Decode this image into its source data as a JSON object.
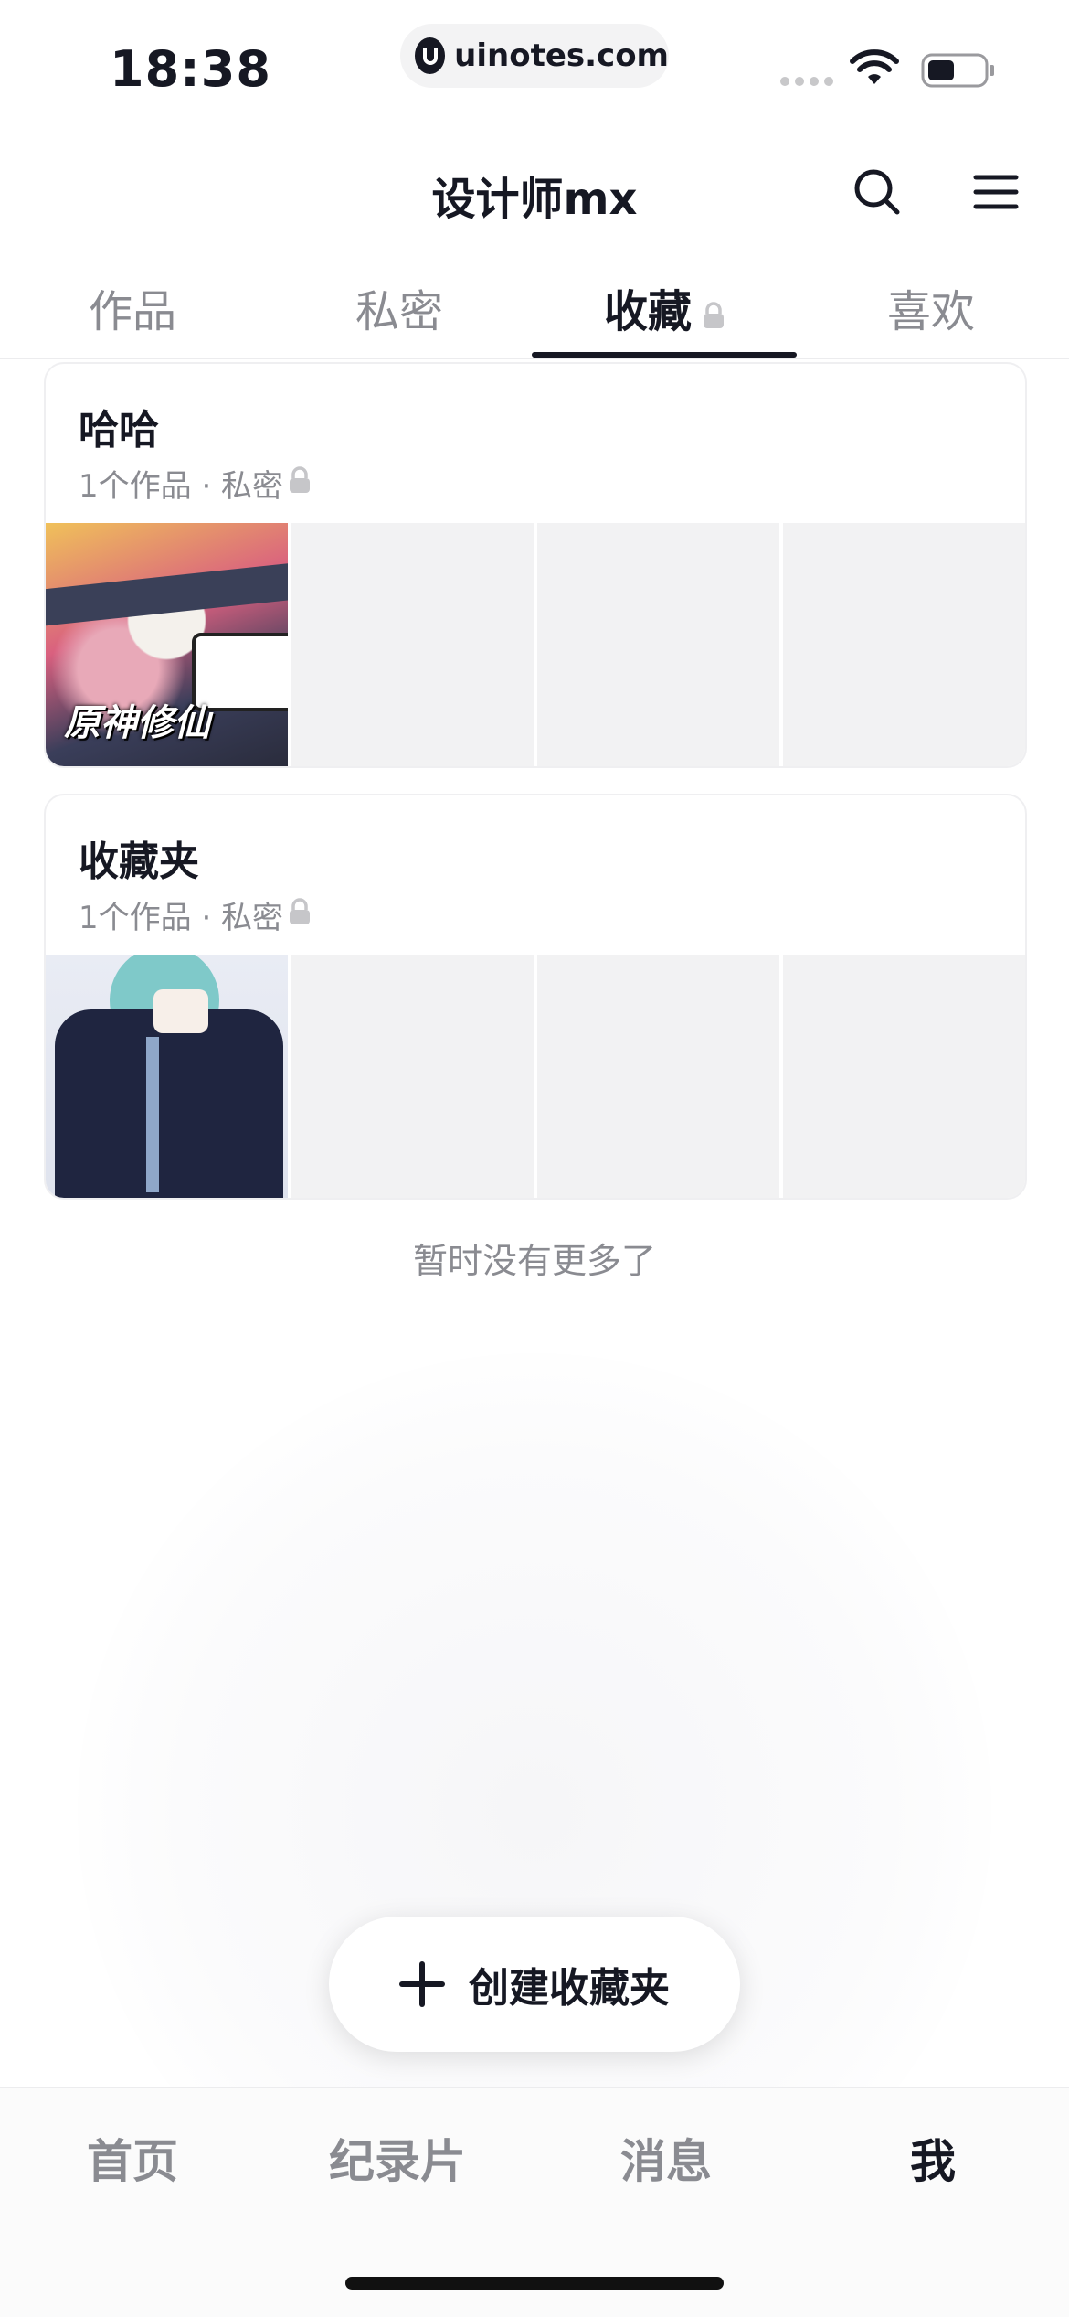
{
  "status_bar": {
    "time": "18:38",
    "url": "uinotes.com",
    "icons": [
      "cellular-icon",
      "wifi-icon",
      "battery-icon"
    ]
  },
  "header": {
    "title": "设计师mx",
    "icons": [
      "search-icon",
      "menu-icon"
    ]
  },
  "tabs": [
    {
      "label": "作品",
      "active": false
    },
    {
      "label": "私密",
      "active": false
    },
    {
      "label": "收藏",
      "active": true,
      "locked": true
    },
    {
      "label": "喜欢",
      "active": false
    }
  ],
  "folders": [
    {
      "name": "哈哈",
      "meta": "1个作品 · 私密",
      "locked": true,
      "thumb_caption": "原神修仙"
    },
    {
      "name": "收藏夹",
      "meta": "1个作品 · 私密",
      "locked": true
    }
  ],
  "no_more_text": "暂时没有更多了",
  "create_button": {
    "label": "创建收藏夹",
    "icon": "plus-icon"
  },
  "bottom_nav": [
    {
      "label": "首页",
      "active": false
    },
    {
      "label": "纪录片",
      "active": false
    },
    {
      "label": "消息",
      "active": false
    },
    {
      "label": "我",
      "active": true
    }
  ],
  "colors": {
    "text_primary": "#161823",
    "text_secondary": "#8a8b91",
    "tab_underline": "#161823",
    "thumb_placeholder": "#f2f2f3"
  }
}
